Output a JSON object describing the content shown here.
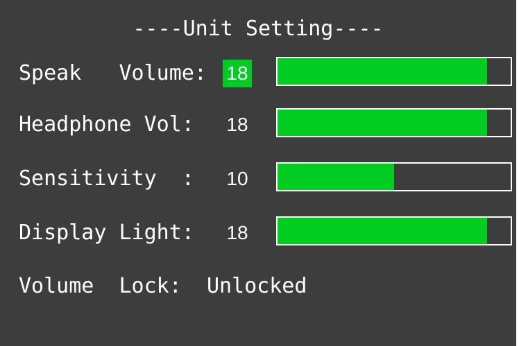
{
  "screen": {
    "title": "----Unit Setting----",
    "rows": [
      {
        "label": "Speak   Volume:",
        "value": "18",
        "level": 0.9,
        "selected": true
      },
      {
        "label": "Headphone Vol:",
        "value": "18",
        "level": 0.9,
        "selected": false
      },
      {
        "label": "Sensitivity  :",
        "value": "10",
        "level": 0.5,
        "selected": false
      },
      {
        "label": "Display Light:",
        "value": "18",
        "level": 0.9,
        "selected": false
      }
    ],
    "lock": {
      "label": "Volume  Lock:",
      "value": "Unlocked"
    }
  },
  "colors": {
    "background": "#3d3d3d",
    "accent_green": "#00cc22",
    "text": "#ffffff"
  }
}
